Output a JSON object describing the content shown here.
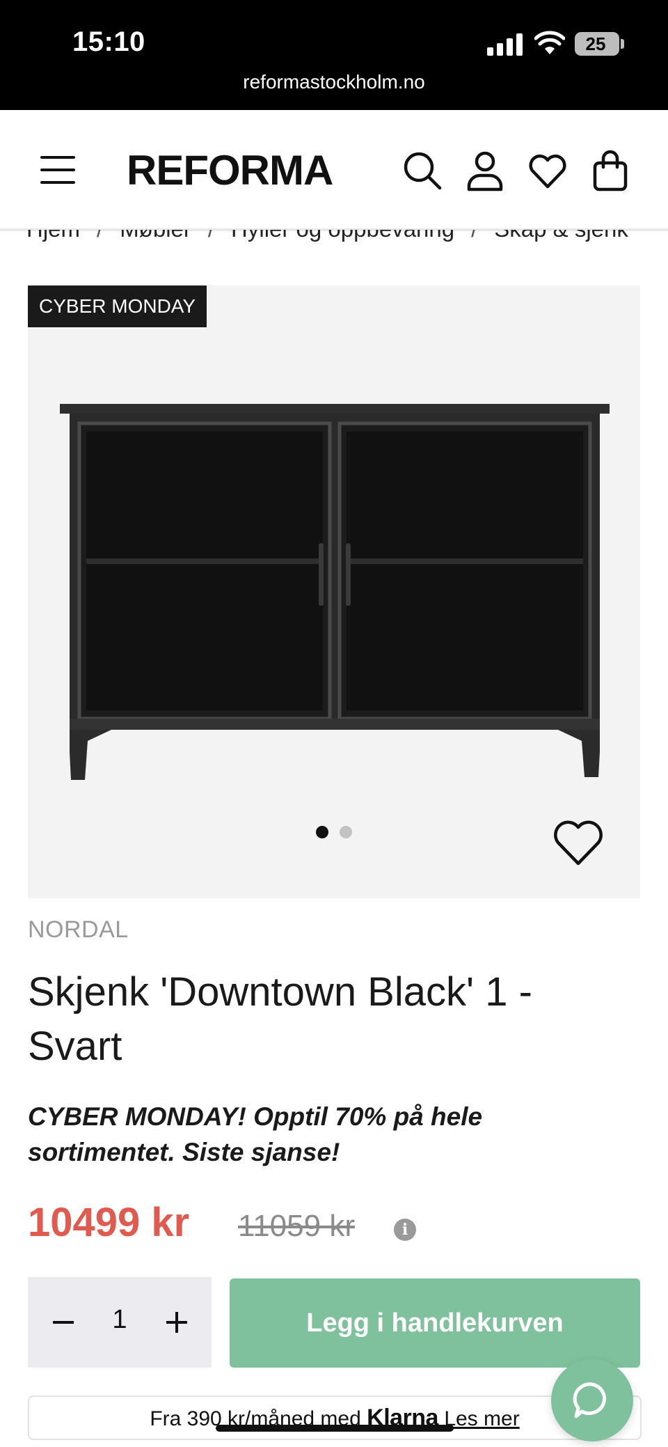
{
  "status_bar": {
    "time": "15:10",
    "battery": "25",
    "url": "reformastockholm.no"
  },
  "header": {
    "logo": "REFORMA",
    "icons": [
      "menu-icon",
      "search-icon",
      "account-icon",
      "wishlist-icon",
      "cart-icon"
    ]
  },
  "breadcrumb": {
    "items": [
      "Hjem",
      "Møbler",
      "Hyller og oppbevaring",
      "Skap & sjenk"
    ],
    "separator": "/"
  },
  "gallery": {
    "badge": "CYBER MONDAY",
    "slide_count": 2,
    "active_slide": 1
  },
  "product": {
    "brand": "NORDAL",
    "title": "Skjenk 'Downtown Black' 1 - Svart",
    "promo": "CYBER MONDAY! Opptil 70% på hele sortimentet. Siste sjanse!",
    "price": "10499 kr",
    "old_price": "11059 kr"
  },
  "purchase": {
    "quantity": "1",
    "add_to_cart_label": "Legg i handlekurven"
  },
  "klarna": {
    "prefix": "Fra 390 kr/måned med",
    "logo": "Klarna",
    "link": "Les mer"
  },
  "colors": {
    "accent": "#7ec19c",
    "sale_price": "#e05a4f",
    "badge_bg": "#1a1a1a"
  }
}
